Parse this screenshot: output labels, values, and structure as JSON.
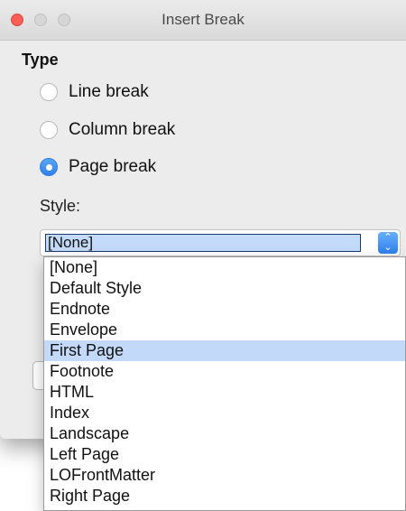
{
  "window": {
    "title": "Insert Break"
  },
  "type_section": {
    "label": "Type",
    "options": [
      {
        "label": "Line break",
        "checked": false
      },
      {
        "label": "Column break",
        "checked": false
      },
      {
        "label": "Page break",
        "checked": true
      }
    ]
  },
  "style": {
    "label": "Style:",
    "selected": "[None]",
    "stepper_icon": "chevron-up-down-icon",
    "options": [
      "[None]",
      "Default Style",
      "Endnote",
      "Envelope",
      "First Page",
      "Footnote",
      "HTML",
      "Index",
      "Landscape",
      "Left Page",
      "LOFrontMatter",
      "Right Page"
    ],
    "highlighted_option": "First Page"
  },
  "colors": {
    "accent": "#2f80ed",
    "highlight": "#c3d9f9",
    "close_light": "#fc5f57"
  }
}
